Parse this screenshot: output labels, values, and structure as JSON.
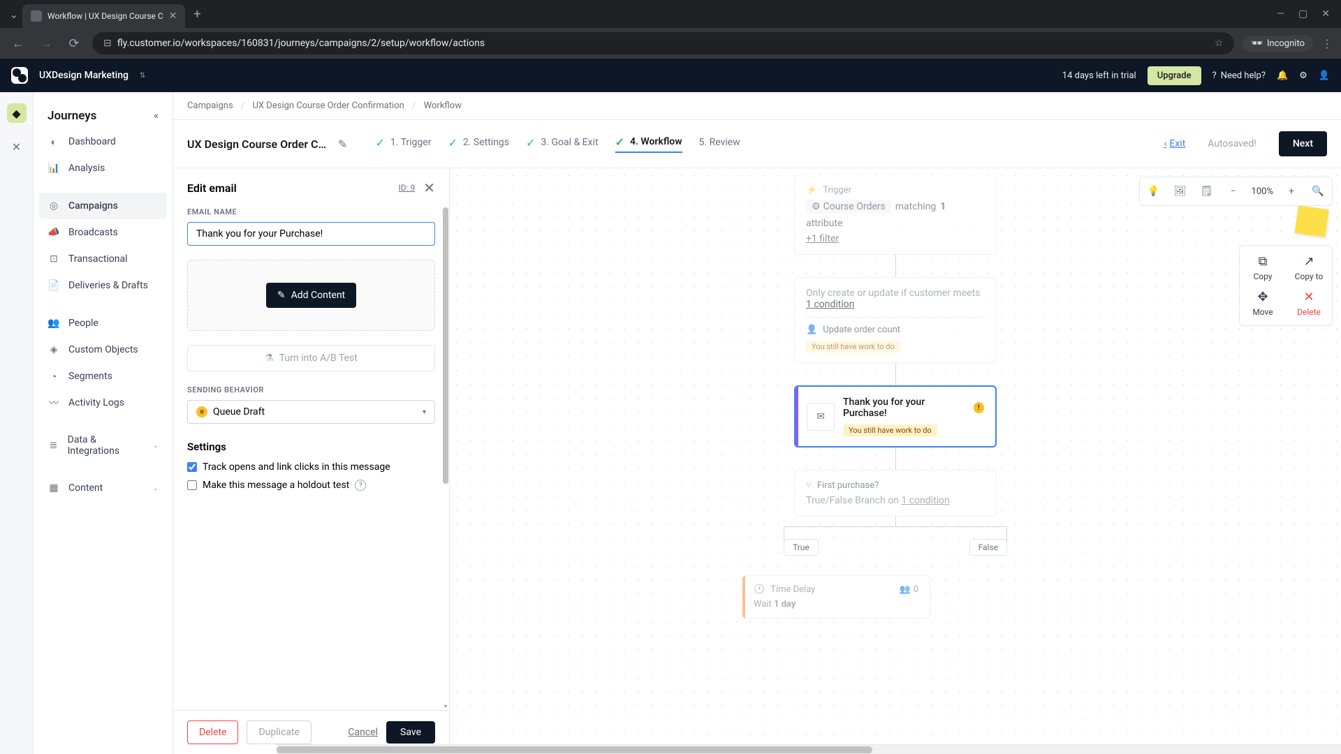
{
  "browser": {
    "tab_title": "Workflow | UX Design Course C",
    "url": "fly.customer.io/workspaces/160831/journeys/campaigns/2/setup/workflow/actions",
    "incognito_label": "Incognito"
  },
  "header": {
    "workspace": "UXDesign Marketing",
    "trial_text": "14 days left in trial",
    "upgrade": "Upgrade",
    "need_help": "Need help?"
  },
  "sidebar": {
    "title": "Journeys",
    "items": {
      "dashboard": "Dashboard",
      "analysis": "Analysis",
      "campaigns": "Campaigns",
      "broadcasts": "Broadcasts",
      "transactional": "Transactional",
      "deliveries": "Deliveries & Drafts",
      "people": "People",
      "custom_objects": "Custom Objects",
      "segments": "Segments",
      "activity_logs": "Activity Logs",
      "data_integrations": "Data & Integrations",
      "content": "Content"
    }
  },
  "breadcrumb": {
    "campaigns": "Campaigns",
    "campaign_name": "UX Design Course Order Confirmation",
    "workflow": "Workflow"
  },
  "steps_bar": {
    "campaign_title": "UX Design Course Order Confir...",
    "step1": "1. Trigger",
    "step2": "2. Settings",
    "step3": "3. Goal & Exit",
    "step4": "4. Workflow",
    "step5": "5. Review",
    "exit": "Exit",
    "autosaved": "Autosaved!",
    "next": "Next"
  },
  "edit_panel": {
    "title": "Edit email",
    "id_label": "ID: 9",
    "email_name_label": "EMAIL NAME",
    "email_name_value": "Thank you for your Purchase! ",
    "add_content": "Add Content",
    "ab_test": "Turn into A/B Test",
    "sending_behavior_label": "SENDING BEHAVIOR",
    "sending_behavior_value": "Queue Draft",
    "settings_heading": "Settings",
    "track_opens": "Track opens and link clicks in this message",
    "holdout_test": "Make this message a holdout test",
    "delete": "Delete",
    "duplicate": "Duplicate",
    "cancel": "Cancel",
    "save": "Save"
  },
  "canvas": {
    "zoom": "100%",
    "trigger_label": "Trigger",
    "trigger_segment": "Course Orders",
    "trigger_matching": "matching",
    "trigger_attr_count": "1",
    "trigger_attr_label": "attribute",
    "trigger_filter": "+1 filter",
    "condition_text1": "Only create or update if customer meets",
    "condition_link": "1 condition",
    "update_order": "Update order count",
    "work_to_do": "You still have work to do",
    "email_title": "Thank you for your Purchase!",
    "first_purchase": "First purchase?",
    "branch_text": "True/False Branch on ",
    "branch_link": "1 condition",
    "true_label": "True",
    "false_label": "False",
    "time_delay": "Time Delay",
    "delay_count": "0",
    "wait_text": "Wait ",
    "wait_duration": "1 day",
    "palette_copy": "Copy",
    "palette_copy_to": "Copy to",
    "palette_move": "Move",
    "palette_delete": "Delete"
  }
}
